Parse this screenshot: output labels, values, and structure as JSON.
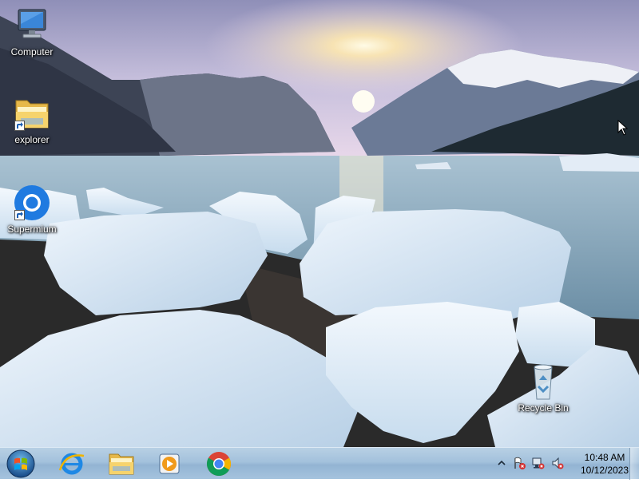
{
  "desktop": {
    "icons": [
      {
        "label": "Computer",
        "icon": "computer-icon"
      },
      {
        "label": "explorer",
        "icon": "folder-icon"
      },
      {
        "label": "Supermium",
        "icon": "supermium-icon"
      },
      {
        "label": "Recycle Bin",
        "icon": "recycle-bin-icon"
      }
    ]
  },
  "taskbar": {
    "pinned": [
      {
        "name": "Internet Explorer",
        "icon": "internet-explorer-icon"
      },
      {
        "name": "Windows Explorer",
        "icon": "folder-icon"
      },
      {
        "name": "Windows Media Player",
        "icon": "media-player-icon"
      },
      {
        "name": "Google Chrome",
        "icon": "chrome-icon"
      }
    ],
    "tray": {
      "time": "10:48 AM",
      "date": "10/12/2023",
      "icons": [
        "show-hidden-icons-chevron",
        "action-center-flag-icon",
        "network-icon",
        "volume-muted-icon"
      ]
    }
  },
  "colors": {
    "taskbar": "#a3c1dc",
    "sky": "#c8c3dc",
    "water": "#7e9cb0",
    "ice": "#e4eef8"
  }
}
